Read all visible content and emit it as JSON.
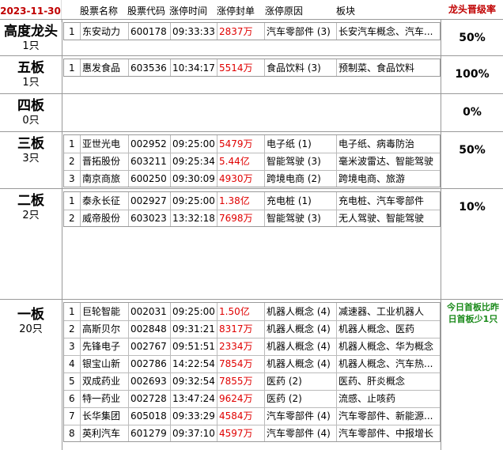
{
  "header": {
    "date": "2023-11-30",
    "columns": [
      "股票名称",
      "股票代码",
      "涨停时间",
      "涨停封单",
      "涨停原因",
      "板块"
    ],
    "rate_title": "龙头晋级率"
  },
  "tiers": [
    {
      "name": "高度龙头",
      "count": "1只",
      "rate": "50%",
      "rows": [
        {
          "idx": "1",
          "name": "东安动力",
          "code": "600178",
          "time": "09:33:33",
          "seal": "2837万",
          "reason": "汽车零部件 (3)",
          "sector": "长安汽车概念、汽车..."
        }
      ]
    },
    {
      "name": "五板",
      "count": "1只",
      "rate": "100%",
      "rows": [
        {
          "idx": "1",
          "name": "惠发食品",
          "code": "603536",
          "time": "10:34:17",
          "seal": "5514万",
          "reason": "食品饮料 (3)",
          "sector": "预制菜、食品饮料"
        }
      ]
    },
    {
      "name": "四板",
      "count": "0只",
      "rate": "0%",
      "rows": []
    },
    {
      "name": "三板",
      "count": "3只",
      "rate": "50%",
      "rows": [
        {
          "idx": "1",
          "name": "亚世光电",
          "code": "002952",
          "time": "09:25:00",
          "seal": "5479万",
          "reason": "电子纸 (1)",
          "sector": "电子纸、病毒防治"
        },
        {
          "idx": "2",
          "name": "晋拓股份",
          "code": "603211",
          "time": "09:25:34",
          "seal": "5.44亿",
          "reason": "智能驾驶 (3)",
          "sector": "毫米波雷达、智能驾驶"
        },
        {
          "idx": "3",
          "name": "南京商旅",
          "code": "600250",
          "time": "09:30:09",
          "seal": "4930万",
          "reason": "跨境电商 (2)",
          "sector": "跨境电商、旅游"
        }
      ]
    },
    {
      "name": "二板",
      "count": "2只",
      "rate": "10%",
      "rows": [
        {
          "idx": "1",
          "name": "泰永长征",
          "code": "002927",
          "time": "09:25:00",
          "seal": "1.38亿",
          "reason": "充电桩 (1)",
          "sector": "充电桩、汽车零部件"
        },
        {
          "idx": "2",
          "name": "威帝股份",
          "code": "603023",
          "time": "13:32:18",
          "seal": "7698万",
          "reason": "智能驾驶 (3)",
          "sector": "无人驾驶、智能驾驶"
        }
      ]
    },
    {
      "name": "一板",
      "count": "20只",
      "rate": "今日首板比昨日首板少1只",
      "rows": [
        {
          "idx": "1",
          "name": "巨轮智能",
          "code": "002031",
          "time": "09:25:00",
          "seal": "1.50亿",
          "reason": "机器人概念 (4)",
          "sector": "减速器、工业机器人"
        },
        {
          "idx": "2",
          "name": "高斯贝尔",
          "code": "002848",
          "time": "09:31:21",
          "seal": "8317万",
          "reason": "机器人概念 (4)",
          "sector": "机器人概念、医药"
        },
        {
          "idx": "3",
          "name": "先锋电子",
          "code": "002767",
          "time": "09:51:51",
          "seal": "2334万",
          "reason": "机器人概念 (4)",
          "sector": "机器人概念、华为概念"
        },
        {
          "idx": "4",
          "name": "银宝山新",
          "code": "002786",
          "time": "14:22:54",
          "seal": "7854万",
          "reason": "机器人概念 (4)",
          "sector": "机器人概念、汽车热..."
        },
        {
          "idx": "5",
          "name": "双成药业",
          "code": "002693",
          "time": "09:32:54",
          "seal": "7855万",
          "reason": "医药 (2)",
          "sector": "医药、肝炎概念"
        },
        {
          "idx": "6",
          "name": "特一药业",
          "code": "002728",
          "time": "13:47:24",
          "seal": "9624万",
          "reason": "医药 (2)",
          "sector": "流感、止咳药"
        },
        {
          "idx": "7",
          "name": "长华集团",
          "code": "605018",
          "time": "09:33:29",
          "seal": "4584万",
          "reason": "汽车零部件 (4)",
          "sector": "汽车零部件、新能源..."
        },
        {
          "idx": "8",
          "name": "英利汽车",
          "code": "601279",
          "time": "09:37:10",
          "seal": "4597万",
          "reason": "汽车零部件 (4)",
          "sector": "汽车零部件、中报增长"
        }
      ]
    }
  ]
}
